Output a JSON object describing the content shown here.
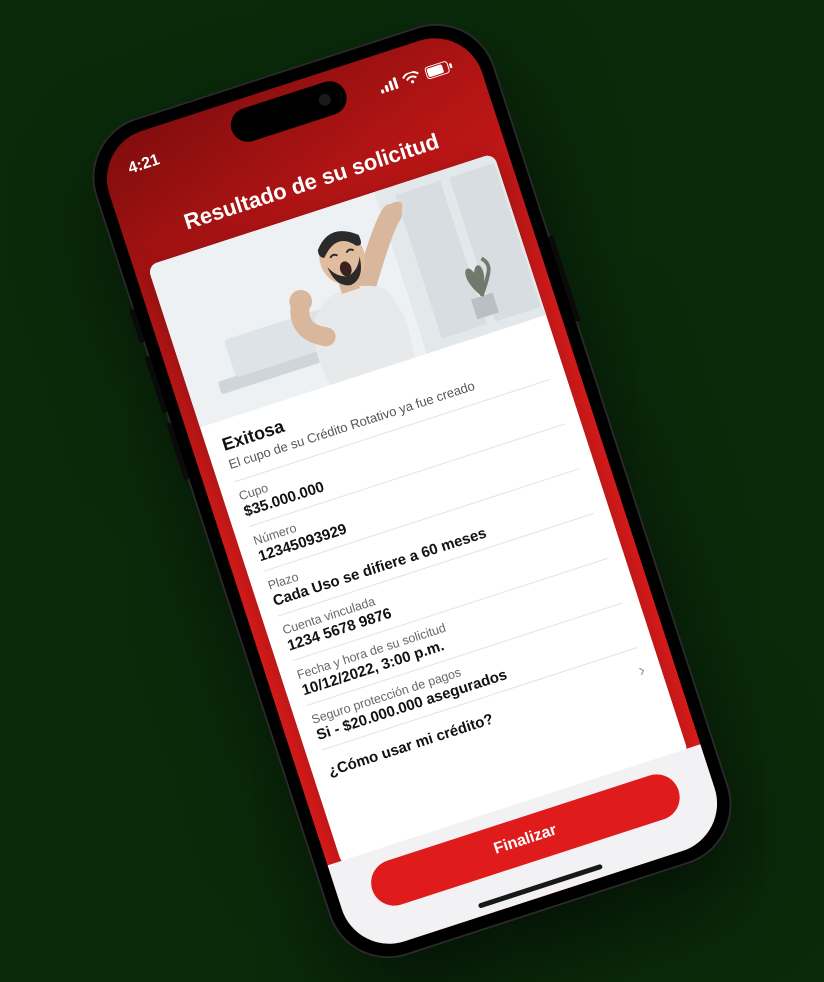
{
  "status_bar": {
    "time": "4:21"
  },
  "header": {
    "title": "Resultado de su solicitud"
  },
  "result": {
    "status_title": "Exitosa",
    "status_subtitle": "El cupo de su Crédito Rotativo ya fue creado"
  },
  "details": [
    {
      "label": "Cupo",
      "value": "$35.000.000"
    },
    {
      "label": "Número",
      "value": "12345093929"
    },
    {
      "label": "Plazo",
      "value": "Cada Uso se difiere a 60 meses"
    },
    {
      "label": "Cuenta vinculada",
      "value": "1234 5678 9876"
    },
    {
      "label": "Fecha y hora de su solicitud",
      "value": "10/12/2022, 3:00 p.m."
    },
    {
      "label": "Seguro protección de pagos",
      "value": "Si - $20.000.000 asegurados"
    }
  ],
  "link_row": {
    "text": "¿Cómo usar mi crédito?"
  },
  "footer": {
    "button": "Finalizar"
  },
  "colors": {
    "brand_red": "#e01b1b"
  }
}
